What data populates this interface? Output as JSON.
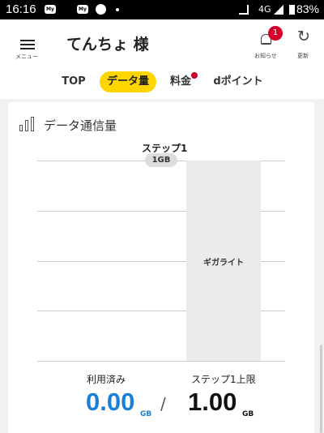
{
  "status_bar": {
    "time": "16:16",
    "app_icon_1": "My",
    "app_icon_2": "My",
    "network": "4G",
    "battery": "83%"
  },
  "header": {
    "menu_label": "メニュー",
    "title": "てんちょ 様",
    "notification_count": "1",
    "notification_label": "お知らせ",
    "refresh_label": "更新"
  },
  "tabs": [
    {
      "label": "TOP",
      "active": false
    },
    {
      "label": "データ量",
      "active": true
    },
    {
      "label": "料金",
      "active": false,
      "has_alert": true
    },
    {
      "label": "dポイント",
      "active": false
    }
  ],
  "card": {
    "title": "データ通信量",
    "used_label": "利用済み",
    "used_value": "0.00",
    "used_unit": "GB",
    "separator": "/",
    "limit_label": "ステップ1上限",
    "limit_value": "1.00",
    "limit_unit": "GB"
  },
  "chart_data": {
    "type": "bar",
    "step_label": "ステップ1",
    "step_limit": "1GB",
    "bar_label": "ギガライト",
    "used": 0.0,
    "limit": 1.0,
    "unit": "GB",
    "bar_fill_fraction": 1.0,
    "gridlines": 5,
    "accent": "#1a7fd6",
    "bar_color": "#ebebeb"
  },
  "colors": {
    "accent_yellow": "#ffd600",
    "used_blue": "#1a7fd6",
    "badge_red": "#d4002a"
  }
}
